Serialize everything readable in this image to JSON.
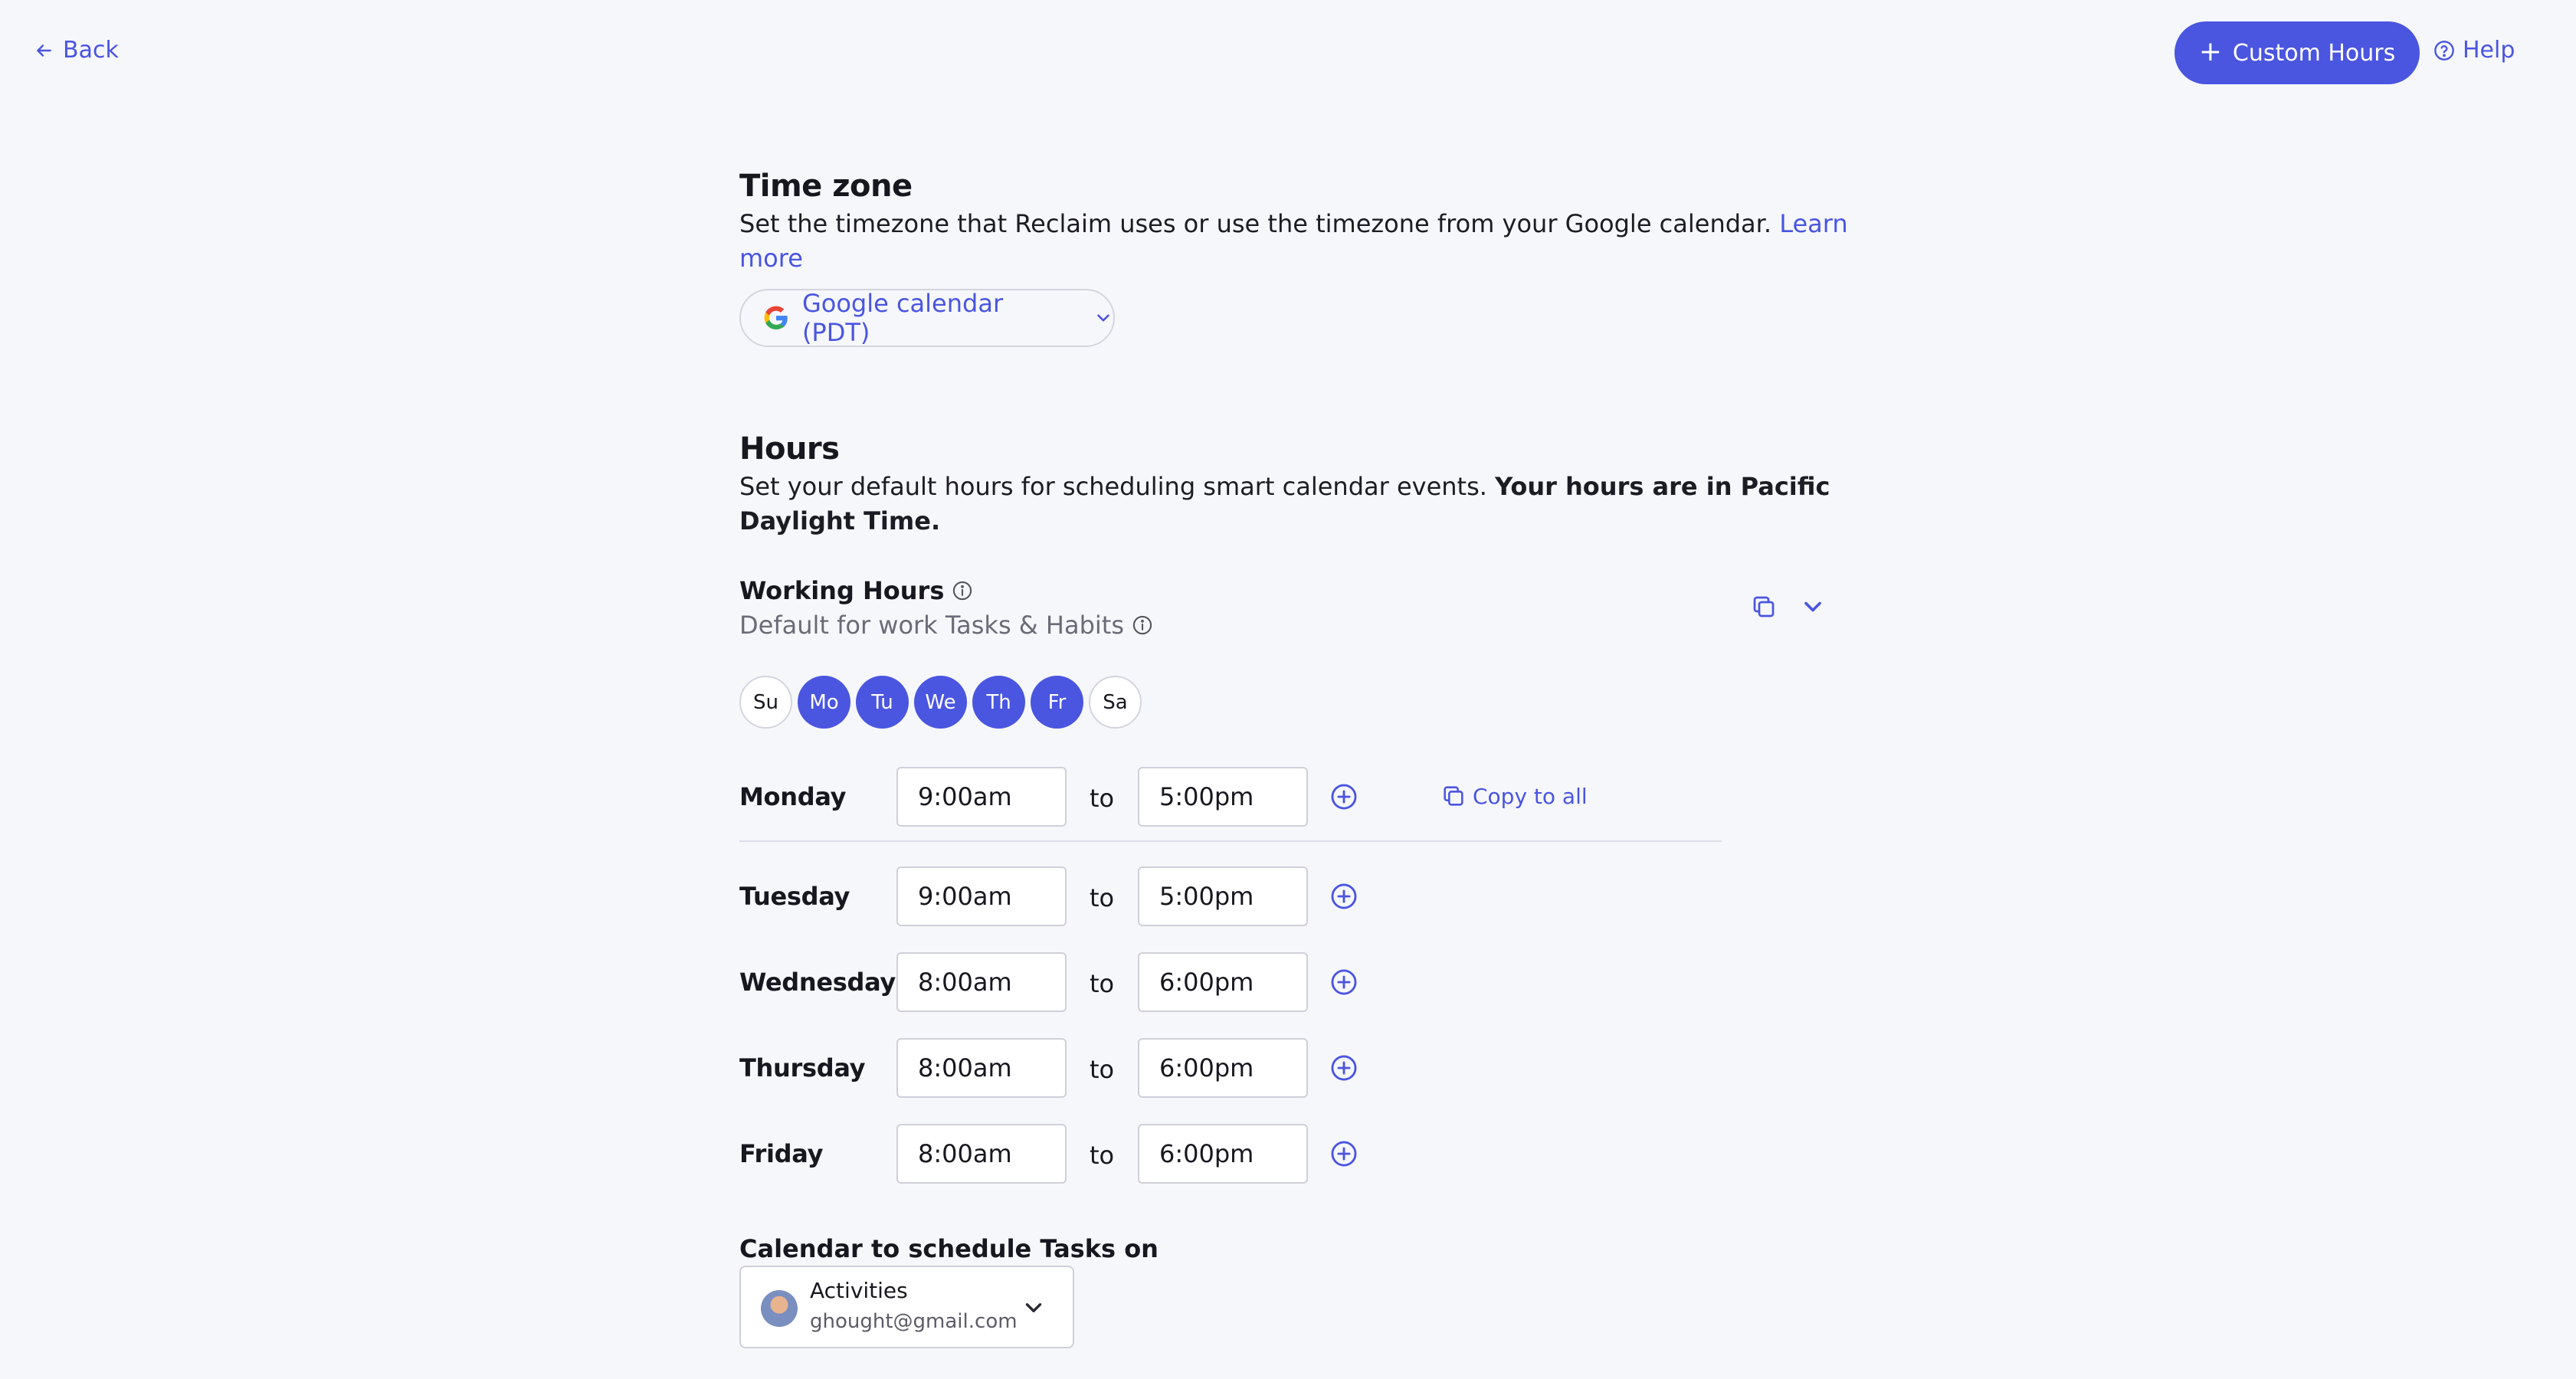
{
  "header": {
    "back_label": "Back",
    "custom_hours_label": "Custom Hours",
    "help_label": "Help"
  },
  "timezone": {
    "title": "Time zone",
    "description": "Set the timezone that Reclaim uses or use the timezone from your Google calendar.",
    "learn_more_label": "Learn more",
    "selected": "Google calendar (PDT)"
  },
  "hours": {
    "title": "Hours",
    "description": "Set your default hours for scheduling smart calendar events.",
    "description_bold": "Your hours are in Pacific Daylight Time.",
    "working_hours": {
      "title": "Working Hours",
      "subtitle": "Default for work Tasks & Habits",
      "days": [
        {
          "label": "Su",
          "active": false
        },
        {
          "label": "Mo",
          "active": true
        },
        {
          "label": "Tu",
          "active": true
        },
        {
          "label": "We",
          "active": true
        },
        {
          "label": "Th",
          "active": true
        },
        {
          "label": "Fr",
          "active": true
        },
        {
          "label": "Sa",
          "active": false
        }
      ],
      "to_label": "to",
      "copy_to_all_label": "Copy to all",
      "rows": [
        {
          "day": "Monday",
          "start": "9:00am",
          "end": "5:00pm"
        },
        {
          "day": "Tuesday",
          "start": "9:00am",
          "end": "5:00pm"
        },
        {
          "day": "Wednesday",
          "start": "8:00am",
          "end": "6:00pm"
        },
        {
          "day": "Thursday",
          "start": "8:00am",
          "end": "6:00pm"
        },
        {
          "day": "Friday",
          "start": "8:00am",
          "end": "6:00pm"
        }
      ]
    }
  },
  "calendar": {
    "title": "Calendar to schedule Tasks on",
    "selected_name": "Activities",
    "selected_email": "ghought@gmail.com"
  },
  "colors": {
    "accent": "#4a55e0",
    "background": "#f6f7fb"
  }
}
